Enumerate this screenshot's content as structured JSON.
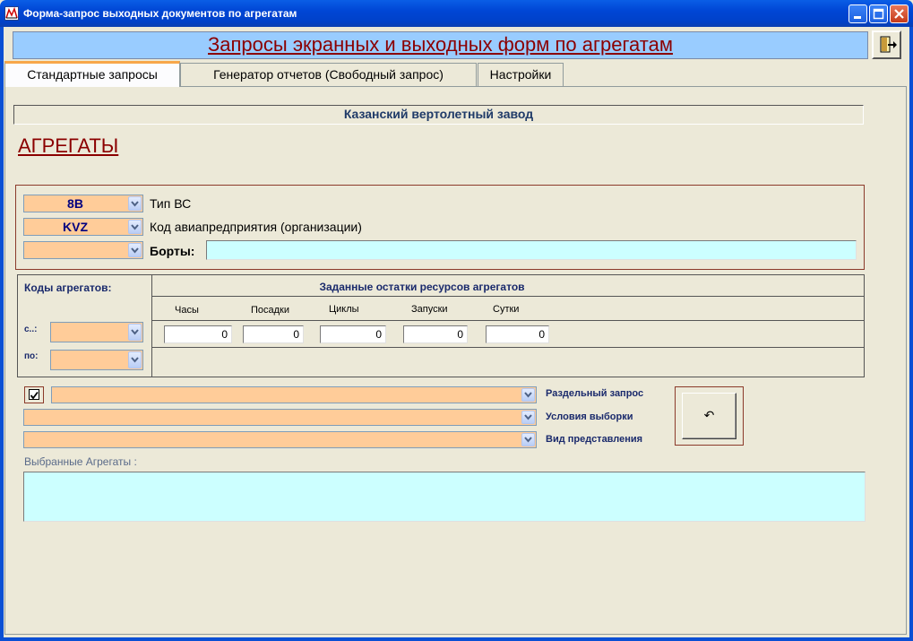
{
  "window": {
    "title": "Форма-запрос выходных документов по агрегатам",
    "minimize_icon": "minimize-icon",
    "maximize_icon": "maximize-icon",
    "close_icon": "close-icon"
  },
  "header": {
    "title": "Запросы экранных и выходных форм по агрегатам",
    "exit_icon": "exit-door-icon"
  },
  "tabs": [
    {
      "label": "Стандартные запросы",
      "active": true
    },
    {
      "label": "Генератор отчетов (Свободный запрос)",
      "active": false
    },
    {
      "label": "Настройки",
      "active": false
    }
  ],
  "company": "Казанский вертолетный завод",
  "section_title": "АГРЕГАТЫ ",
  "aircraft": {
    "type_value": "8В",
    "type_label": "Тип ВС",
    "org_value": "KVZ",
    "org_label": "Код авиапредприятия (организации)",
    "boards_value": "",
    "boards_label": "Борты:",
    "boards_input_value": ""
  },
  "codes": {
    "heading": "Коды агрегатов:",
    "from_label": "с..:",
    "to_label": "по:",
    "from_value": "",
    "to_value": ""
  },
  "resources": {
    "heading": "Заданные остатки ресурсов агрегатов",
    "columns": [
      {
        "label": "Часы",
        "value": "0"
      },
      {
        "label": "Посадки",
        "value": "0"
      },
      {
        "label": "Циклы",
        "value": "0"
      },
      {
        "label": "Запуски",
        "value": "0"
      },
      {
        "label": "Сутки",
        "value": "0"
      }
    ]
  },
  "query": {
    "separate_checked": true,
    "separate_label": "Раздельный запрос",
    "conditions_label": "Условия выборки",
    "view_label": "Вид представления",
    "separate_value": "",
    "conditions_value": "",
    "view_value": "",
    "reset_glyph": "↶"
  },
  "selected": {
    "label": "Выбранные Агрегаты :",
    "value": ""
  },
  "colors": {
    "combo_bg": "#ffcc99",
    "cyan_field": "#ccffff",
    "header_bg": "#99ccff",
    "title_red": "#8b0000",
    "label_blue": "#1a2a6c"
  }
}
